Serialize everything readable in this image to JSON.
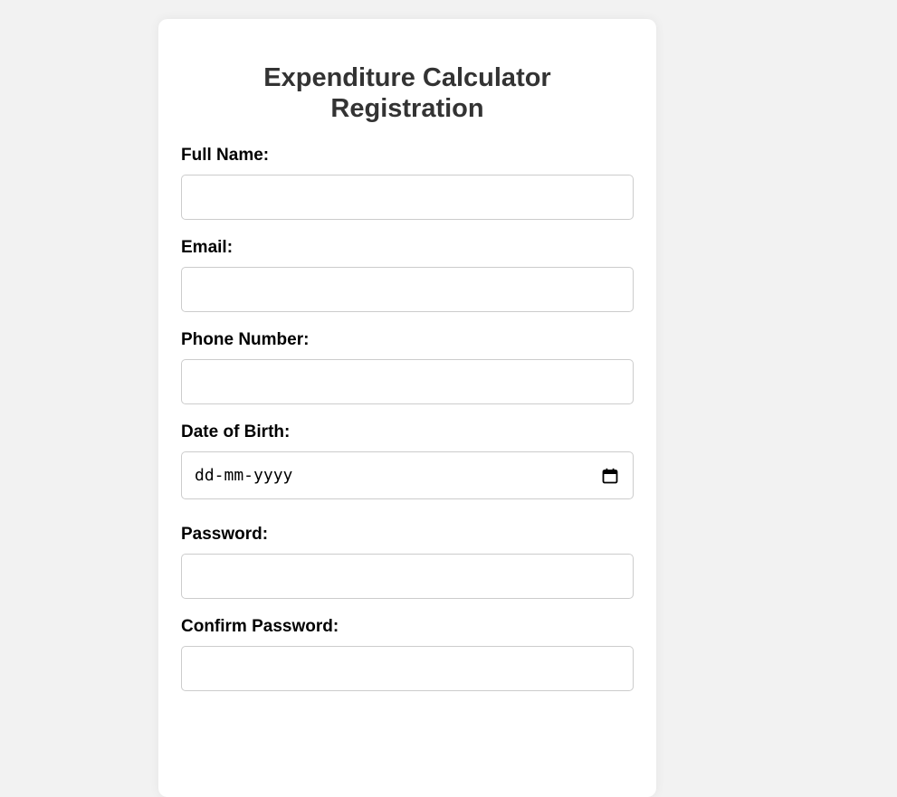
{
  "form": {
    "title": "Expenditure Calculator Registration",
    "fields": [
      {
        "label": "Full Name:",
        "value": ""
      },
      {
        "label": "Email:",
        "value": ""
      },
      {
        "label": "Phone Number:",
        "value": ""
      },
      {
        "label": "Date of Birth:",
        "placeholder": "dd-mm-yyyy"
      },
      {
        "label": "Password:",
        "value": ""
      },
      {
        "label": "Confirm Password:",
        "value": ""
      }
    ]
  },
  "icons": {
    "date_picker": "calendar-icon"
  },
  "colors": {
    "page_background": "#f2f2f2",
    "card_background": "#ffffff",
    "title": "#333333",
    "input_border": "#cccccc"
  }
}
